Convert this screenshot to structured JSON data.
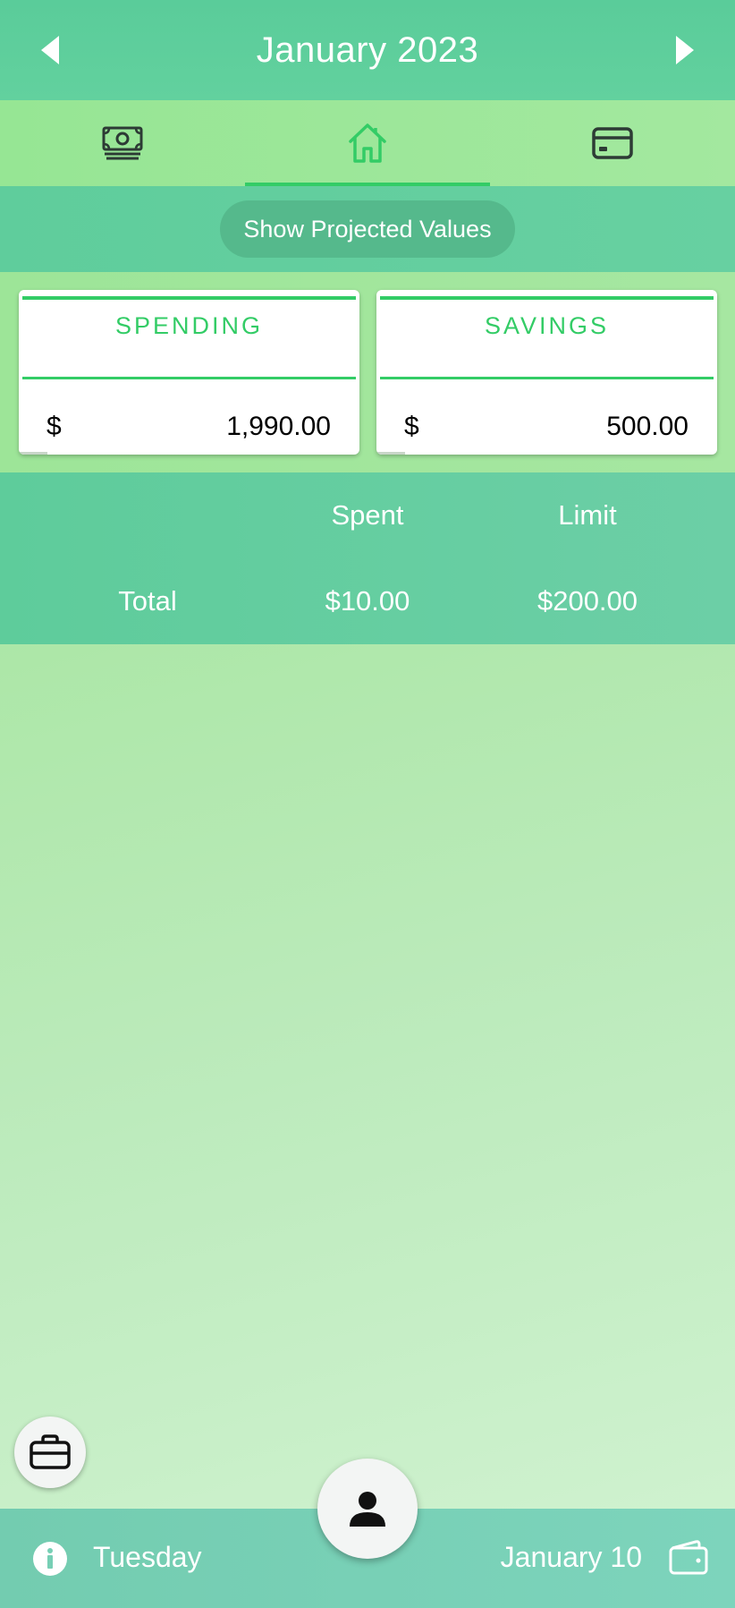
{
  "header": {
    "title": "January 2023",
    "prev_icon": "chevron-left-icon",
    "next_icon": "chevron-right-icon"
  },
  "tabs": [
    {
      "name": "cash",
      "icon": "cash-icon",
      "active": false
    },
    {
      "name": "home",
      "icon": "home-icon",
      "active": true
    },
    {
      "name": "card",
      "icon": "credit-card-icon",
      "active": false
    }
  ],
  "projected": {
    "label": "Show Projected Values"
  },
  "cards": {
    "spending": {
      "label": "SPENDING",
      "currency": "$",
      "amount": "1,990.00"
    },
    "savings": {
      "label": "SAVINGS",
      "currency": "$",
      "amount": "500.00"
    }
  },
  "summary": {
    "headers": {
      "spent": "Spent",
      "limit": "Limit"
    },
    "total": {
      "label": "Total",
      "spent": "$10.00",
      "limit": "$200.00"
    }
  },
  "footer": {
    "day": "Tuesday",
    "date": "January 10",
    "info_icon": "info-icon",
    "wallet_icon": "wallet-icon"
  },
  "fabs": {
    "left_icon": "briefcase-icon",
    "center_icon": "person-icon"
  },
  "colors": {
    "accent": "#33cc66",
    "header": "#5acc9a",
    "tabs": "#9de598",
    "footer": "#77cfb5"
  }
}
